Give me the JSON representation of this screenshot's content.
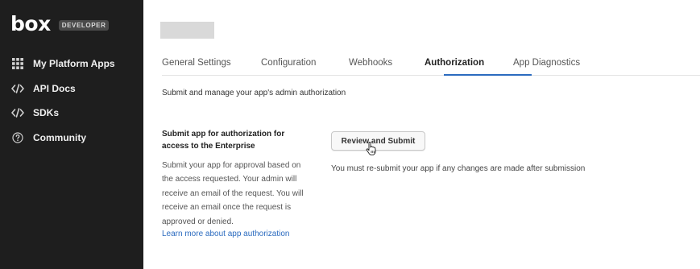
{
  "sidebar": {
    "logo_text": "box",
    "badge_text": "DEVELOPER",
    "items": [
      {
        "label": "My Platform Apps",
        "icon": "grid-icon"
      },
      {
        "label": "API Docs",
        "icon": "code-icon"
      },
      {
        "label": "SDKs",
        "icon": "code-icon"
      },
      {
        "label": "Community",
        "icon": "question-circle-icon"
      }
    ]
  },
  "main": {
    "tabs": [
      {
        "label": "General Settings"
      },
      {
        "label": "Configuration"
      },
      {
        "label": "Webhooks"
      },
      {
        "label": "Authorization",
        "active": true
      },
      {
        "label": "App Diagnostics"
      }
    ],
    "subtitle": "Submit and manage your app's admin authorization",
    "section": {
      "heading": "Submit app for authorization for access to the Enterprise",
      "description": "Submit your app for approval based on the access requested. Your admin will receive an email of the request. You will receive an email once the request is approved or denied.",
      "link_text": "Learn more about app authorization"
    },
    "review_button_label": "Review and Submit",
    "notice": "You must re-submit your app if any changes are made after submission"
  },
  "colors": {
    "sidebar_bg": "#1e1e1e",
    "accent": "#2b6bbf"
  }
}
